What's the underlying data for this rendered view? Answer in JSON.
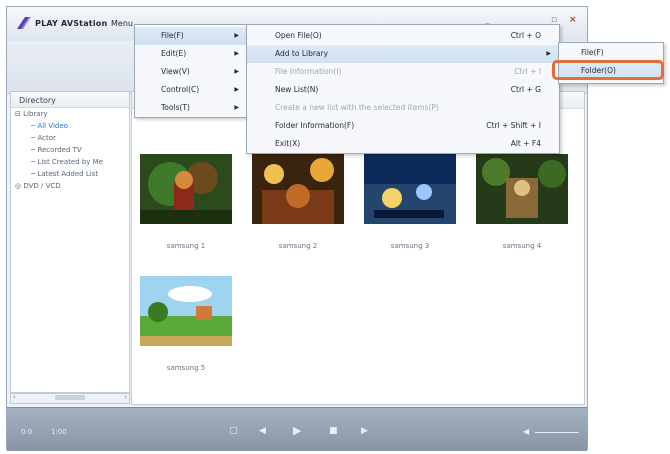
{
  "app": {
    "title": "PLAY AVStation",
    "menu_label": "Menu",
    "controls": [
      "_",
      "×"
    ]
  },
  "sidebar": {
    "header": "Directory",
    "tree": [
      {
        "label": "Library",
        "indent": 0
      },
      {
        "label": "All Video",
        "indent": 1,
        "selected": true
      },
      {
        "label": "Actor",
        "indent": 1
      },
      {
        "label": "Recorded TV",
        "indent": 1
      },
      {
        "label": "List Created by Me",
        "indent": 1
      },
      {
        "label": "Latest Added List",
        "indent": 1
      },
      {
        "label": "DVD / VCD",
        "indent": 0
      }
    ]
  },
  "thumbnails": [
    {
      "label": "samsung 1"
    },
    {
      "label": "samsung 2"
    },
    {
      "label": "samsung 3"
    },
    {
      "label": "samsung 4"
    },
    {
      "label": "samsung 5"
    }
  ],
  "main_menu": [
    {
      "label": "File(F)"
    },
    {
      "label": "Edit(E)"
    },
    {
      "label": "View(V)"
    },
    {
      "label": "Control(C)"
    },
    {
      "label": "Tools(T)"
    }
  ],
  "file_menu": [
    {
      "label": "Open File(O)",
      "shortcut": "Ctrl + O"
    },
    {
      "label": "Add to Library",
      "shortcut": ""
    },
    {
      "label": "File Information(I)",
      "shortcut": "Ctrl + I"
    },
    {
      "label": "New List(N)",
      "shortcut": "Ctrl + G"
    },
    {
      "label": "Create a new list with the selected items(P)",
      "shortcut": ""
    },
    {
      "label": "Folder Information(F)",
      "shortcut": "Ctrl + Shift + I"
    },
    {
      "label": "Exit(X)",
      "shortcut": "Alt + F4"
    }
  ],
  "library_submenu": [
    {
      "label": "File(F)"
    },
    {
      "label": "Folder(O)"
    }
  ],
  "player": {
    "left_a": "0:0",
    "left_b": "1:00"
  },
  "colors": {
    "highlight_box": "#e46d3c",
    "selected_tree": "#2d6fd1",
    "player_bar": "#8795a6"
  }
}
